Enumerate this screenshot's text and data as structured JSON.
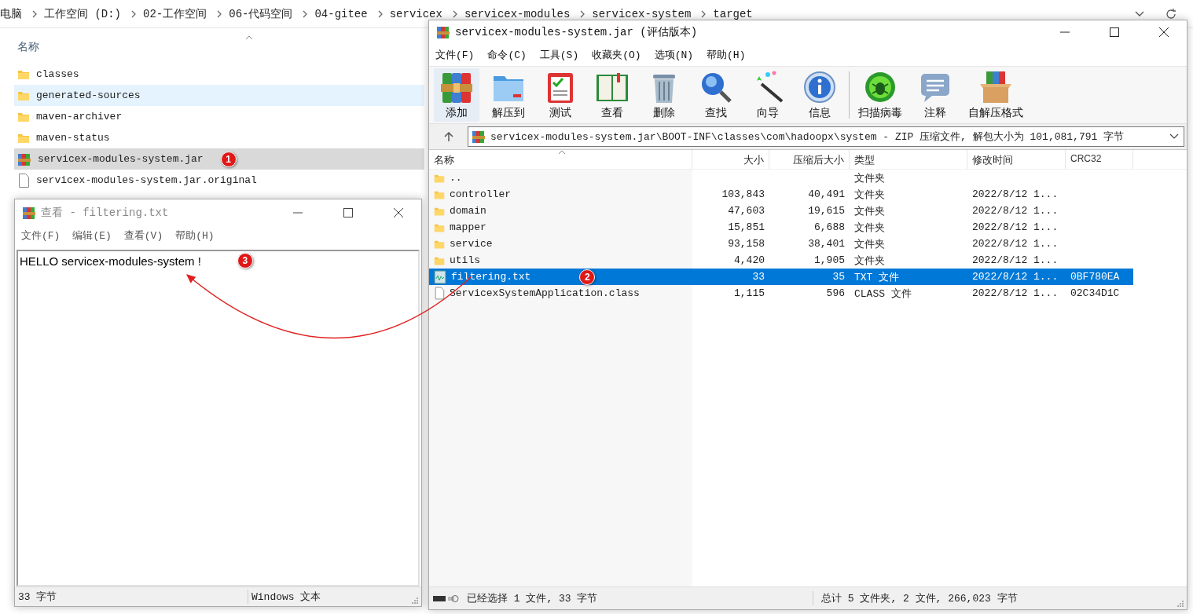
{
  "explorer": {
    "breadcrumbs": [
      "电脑",
      "工作空间 (D:)",
      "02-工作空间",
      "06-代码空间",
      "04-gitee",
      "servicex",
      "servicex-modules",
      "servicex-system",
      "target"
    ],
    "column": "名称",
    "items": [
      {
        "name": "classes",
        "kind": "folder",
        "selected": false,
        "hovered": false
      },
      {
        "name": "generated-sources",
        "kind": "folder",
        "selected": false,
        "hovered": true
      },
      {
        "name": "maven-archiver",
        "kind": "folder",
        "selected": false,
        "hovered": false
      },
      {
        "name": "maven-status",
        "kind": "folder",
        "selected": false,
        "hovered": false
      },
      {
        "name": "servicex-modules-system.jar",
        "kind": "archive",
        "selected": true,
        "hovered": false,
        "badge": "1"
      },
      {
        "name": "servicex-modules-system.jar.original",
        "kind": "file",
        "selected": false,
        "hovered": false
      }
    ]
  },
  "viewer": {
    "title": "查看 - filtering.txt",
    "menu": [
      "文件(F)",
      "编辑(E)",
      "查看(V)",
      "帮助(H)"
    ],
    "content": "HELLO servicex-modules-system !",
    "badge": "3",
    "status": [
      "33 字节",
      "Windows 文本"
    ]
  },
  "archiver": {
    "title": "servicex-modules-system.jar (评估版本)",
    "menu": [
      "文件(F)",
      "命令(C)",
      "工具(S)",
      "收藏夹(O)",
      "选项(N)",
      "帮助(H)"
    ],
    "toolbar": [
      {
        "label": "添加",
        "kind": "add"
      },
      {
        "label": "解压到",
        "kind": "extract"
      },
      {
        "label": "测试",
        "kind": "test"
      },
      {
        "label": "查看",
        "kind": "view"
      },
      {
        "label": "删除",
        "kind": "delete"
      },
      {
        "label": "查找",
        "kind": "find"
      },
      {
        "label": "向导",
        "kind": "wizard"
      },
      {
        "label": "信息",
        "kind": "info"
      },
      {
        "label": "扫描病毒",
        "kind": "scan"
      },
      {
        "label": "注释",
        "kind": "comment"
      },
      {
        "label": "自解压格式",
        "kind": "sfx"
      }
    ],
    "path": "servicex-modules-system.jar\\BOOT-INF\\classes\\com\\hadoopx\\system - ZIP 压缩文件, 解包大小为 101,081,791 字节",
    "columns": [
      "名称",
      "大小",
      "压缩后大小",
      "类型",
      "修改时间",
      "CRC32"
    ],
    "rows": [
      {
        "name": "..",
        "kind": "folder",
        "size": "",
        "packed": "",
        "type": "文件夹",
        "modified": "",
        "crc": "",
        "selected": false
      },
      {
        "name": "controller",
        "kind": "folder",
        "size": "103,843",
        "packed": "40,491",
        "type": "文件夹",
        "modified": "2022/8/12 1...",
        "crc": "",
        "selected": false
      },
      {
        "name": "domain",
        "kind": "folder",
        "size": "47,603",
        "packed": "19,615",
        "type": "文件夹",
        "modified": "2022/8/12 1...",
        "crc": "",
        "selected": false
      },
      {
        "name": "mapper",
        "kind": "folder",
        "size": "15,851",
        "packed": "6,688",
        "type": "文件夹",
        "modified": "2022/8/12 1...",
        "crc": "",
        "selected": false
      },
      {
        "name": "service",
        "kind": "folder",
        "size": "93,158",
        "packed": "38,401",
        "type": "文件夹",
        "modified": "2022/8/12 1...",
        "crc": "",
        "selected": false
      },
      {
        "name": "utils",
        "kind": "folder",
        "size": "4,420",
        "packed": "1,905",
        "type": "文件夹",
        "modified": "2022/8/12 1...",
        "crc": "",
        "selected": false
      },
      {
        "name": "filtering.txt",
        "kind": "text",
        "size": "33",
        "packed": "35",
        "type": "TXT 文件",
        "modified": "2022/8/12 1...",
        "crc": "0BF780EA",
        "selected": true,
        "badge": "2"
      },
      {
        "name": "ServicexSystemApplication.class",
        "kind": "file",
        "size": "1,115",
        "packed": "596",
        "type": "CLASS 文件",
        "modified": "2022/8/12 1...",
        "crc": "02C34D1C",
        "selected": false
      }
    ],
    "status": [
      "已经选择 1 文件, 33 字节",
      "总计 5 文件夹, 2 文件, 266,023 字节"
    ]
  }
}
